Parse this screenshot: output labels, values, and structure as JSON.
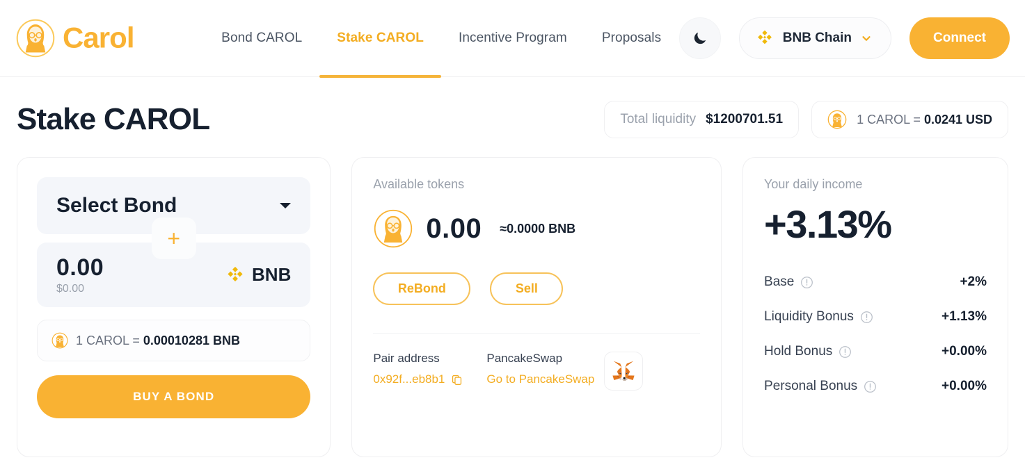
{
  "header": {
    "brand_name": "Carol",
    "logo_icon": "carol-avatar-icon",
    "nav": [
      {
        "label": "Bond CAROL",
        "active": false
      },
      {
        "label": "Stake CAROL",
        "active": true
      },
      {
        "label": "Incentive Program",
        "active": false
      },
      {
        "label": "Proposals",
        "active": false
      }
    ],
    "theme_toggle_icon": "moon-icon",
    "chain": {
      "name": "BNB Chain",
      "icon": "bnb-icon",
      "chevron": "chevron-down-icon"
    },
    "connect_label": "Connect"
  },
  "page": {
    "title": "Stake CAROL",
    "stats": {
      "liquidity_label": "Total liquidity",
      "liquidity_value": "$1200701.51",
      "rate_prefix": "1 CAROL = ",
      "rate_value": "0.0241 USD",
      "rate_icon": "carol-token-icon"
    }
  },
  "bond_card": {
    "select_label": "Select Bond",
    "select_caret": "caret-down-icon",
    "add_icon": "plus-icon",
    "amount": "0.00",
    "amount_usd": "$0.00",
    "token_symbol": "BNB",
    "token_icon": "bnb-icon",
    "rate_prefix": "1 CAROL = ",
    "rate_value": "0.00010281 BNB",
    "rate_icon": "carol-token-icon",
    "buy_label": "BUY A BOND"
  },
  "tokens_card": {
    "available_label": "Available tokens",
    "token_icon": "carol-token-icon",
    "amount": "0.00",
    "approx": "≈",
    "approx_value": "0.0000 BNB",
    "rebond_label": "ReBond",
    "sell_label": "Sell",
    "pair_address_label": "Pair address",
    "pair_address_value": "0x92f...eb8b1",
    "copy_icon": "copy-icon",
    "dex_label": "PancakeSwap",
    "dex_link": "Go to PancakeSwap",
    "wallet_icon": "metamask-fox-icon"
  },
  "income_card": {
    "title": "Your daily income",
    "value": "+3.13%",
    "rows": [
      {
        "label": "Base",
        "value": "+2%",
        "info_icon": "info-icon"
      },
      {
        "label": "Liquidity Bonus",
        "value": "+1.13%",
        "info_icon": "info-icon"
      },
      {
        "label": "Hold Bonus",
        "value": "+0.00%",
        "info_icon": "info-icon"
      },
      {
        "label": "Personal Bonus",
        "value": "+0.00%",
        "info_icon": "info-icon"
      }
    ]
  },
  "colors": {
    "accent": "#F9B233",
    "accent_text": "#F3AD22",
    "ink": "#16202F",
    "muted": "#9AA1AC",
    "border": "#EFEFF1",
    "field_bg": "#F4F6FA"
  }
}
